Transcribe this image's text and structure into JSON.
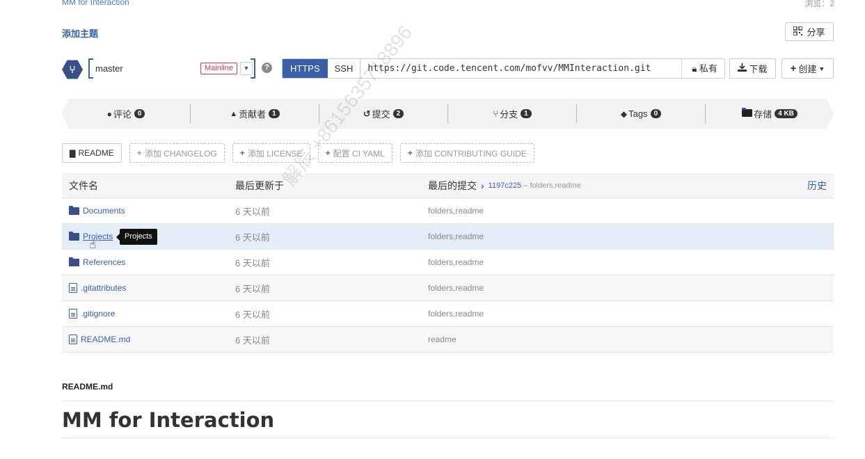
{
  "header": {
    "repo_crumb": "MM for Interaction",
    "views": "浏览：2",
    "add_topic": "添加主题",
    "share_label": "分享"
  },
  "branch": {
    "icon": "branch-icon",
    "name": "master",
    "tag": "Mainline"
  },
  "clone": {
    "https_label": "HTTPS",
    "ssh_label": "SSH",
    "url": "https://git.code.tencent.com/mofvv/MMInteraction.git",
    "private_label": "私有"
  },
  "actions": {
    "download_label": "下载",
    "create_label": "创建"
  },
  "stats": [
    {
      "label": "评论",
      "count": "0",
      "icon": "comment-icon",
      "glyph": "💬"
    },
    {
      "label": "贡献者",
      "count": "1",
      "icon": "user-icon",
      "glyph": "👤"
    },
    {
      "label": "提交",
      "count": "2",
      "icon": "history-icon",
      "glyph": "↺"
    },
    {
      "label": "分支",
      "count": "1",
      "icon": "branch-icon",
      "glyph": "⑂"
    },
    {
      "label": "Tags",
      "count": "0",
      "icon": "tag-icon",
      "glyph": "🏷"
    },
    {
      "label": "存储",
      "count": "4 KB",
      "icon": "folder-icon",
      "glyph": "▆"
    }
  ],
  "doc_buttons": [
    {
      "label": "README",
      "style": "solid"
    },
    {
      "label": "添加 CHANGELOG",
      "style": "dash"
    },
    {
      "label": "添加 LICENSE",
      "style": "dash"
    },
    {
      "label": "配置 CI YAML",
      "style": "dash"
    },
    {
      "label": "添加 CONTRIBUTING GUIDE",
      "style": "dash"
    }
  ],
  "table": {
    "headers": {
      "name": "文件名",
      "updated": "最后更新于",
      "commit": "最后的提交",
      "history": "历史"
    },
    "last_commit_sha": "1197c225",
    "last_commit_msg": "– folders,readme",
    "rows": [
      {
        "name": "Documents",
        "type": "folder",
        "updated": "6 天以前",
        "commit": "folders,readme"
      },
      {
        "name": "Projects",
        "type": "folder",
        "updated": "6 天以前",
        "commit": "folders,readme"
      },
      {
        "name": "References",
        "type": "folder",
        "updated": "6 天以前",
        "commit": "folders,readme"
      },
      {
        "name": ".gitattributes",
        "type": "file",
        "updated": "6 天以前",
        "commit": "folders,readme"
      },
      {
        "name": ".gitignore",
        "type": "file",
        "updated": "6 天以前",
        "commit": "folders,readme"
      },
      {
        "name": "README.md",
        "type": "file",
        "updated": "6 天以前",
        "commit": "readme"
      }
    ]
  },
  "tooltip": "Projects",
  "readme": {
    "label": "README.md",
    "title": "MM for Interaction"
  },
  "watermark": "解辰 +8615635718896"
}
